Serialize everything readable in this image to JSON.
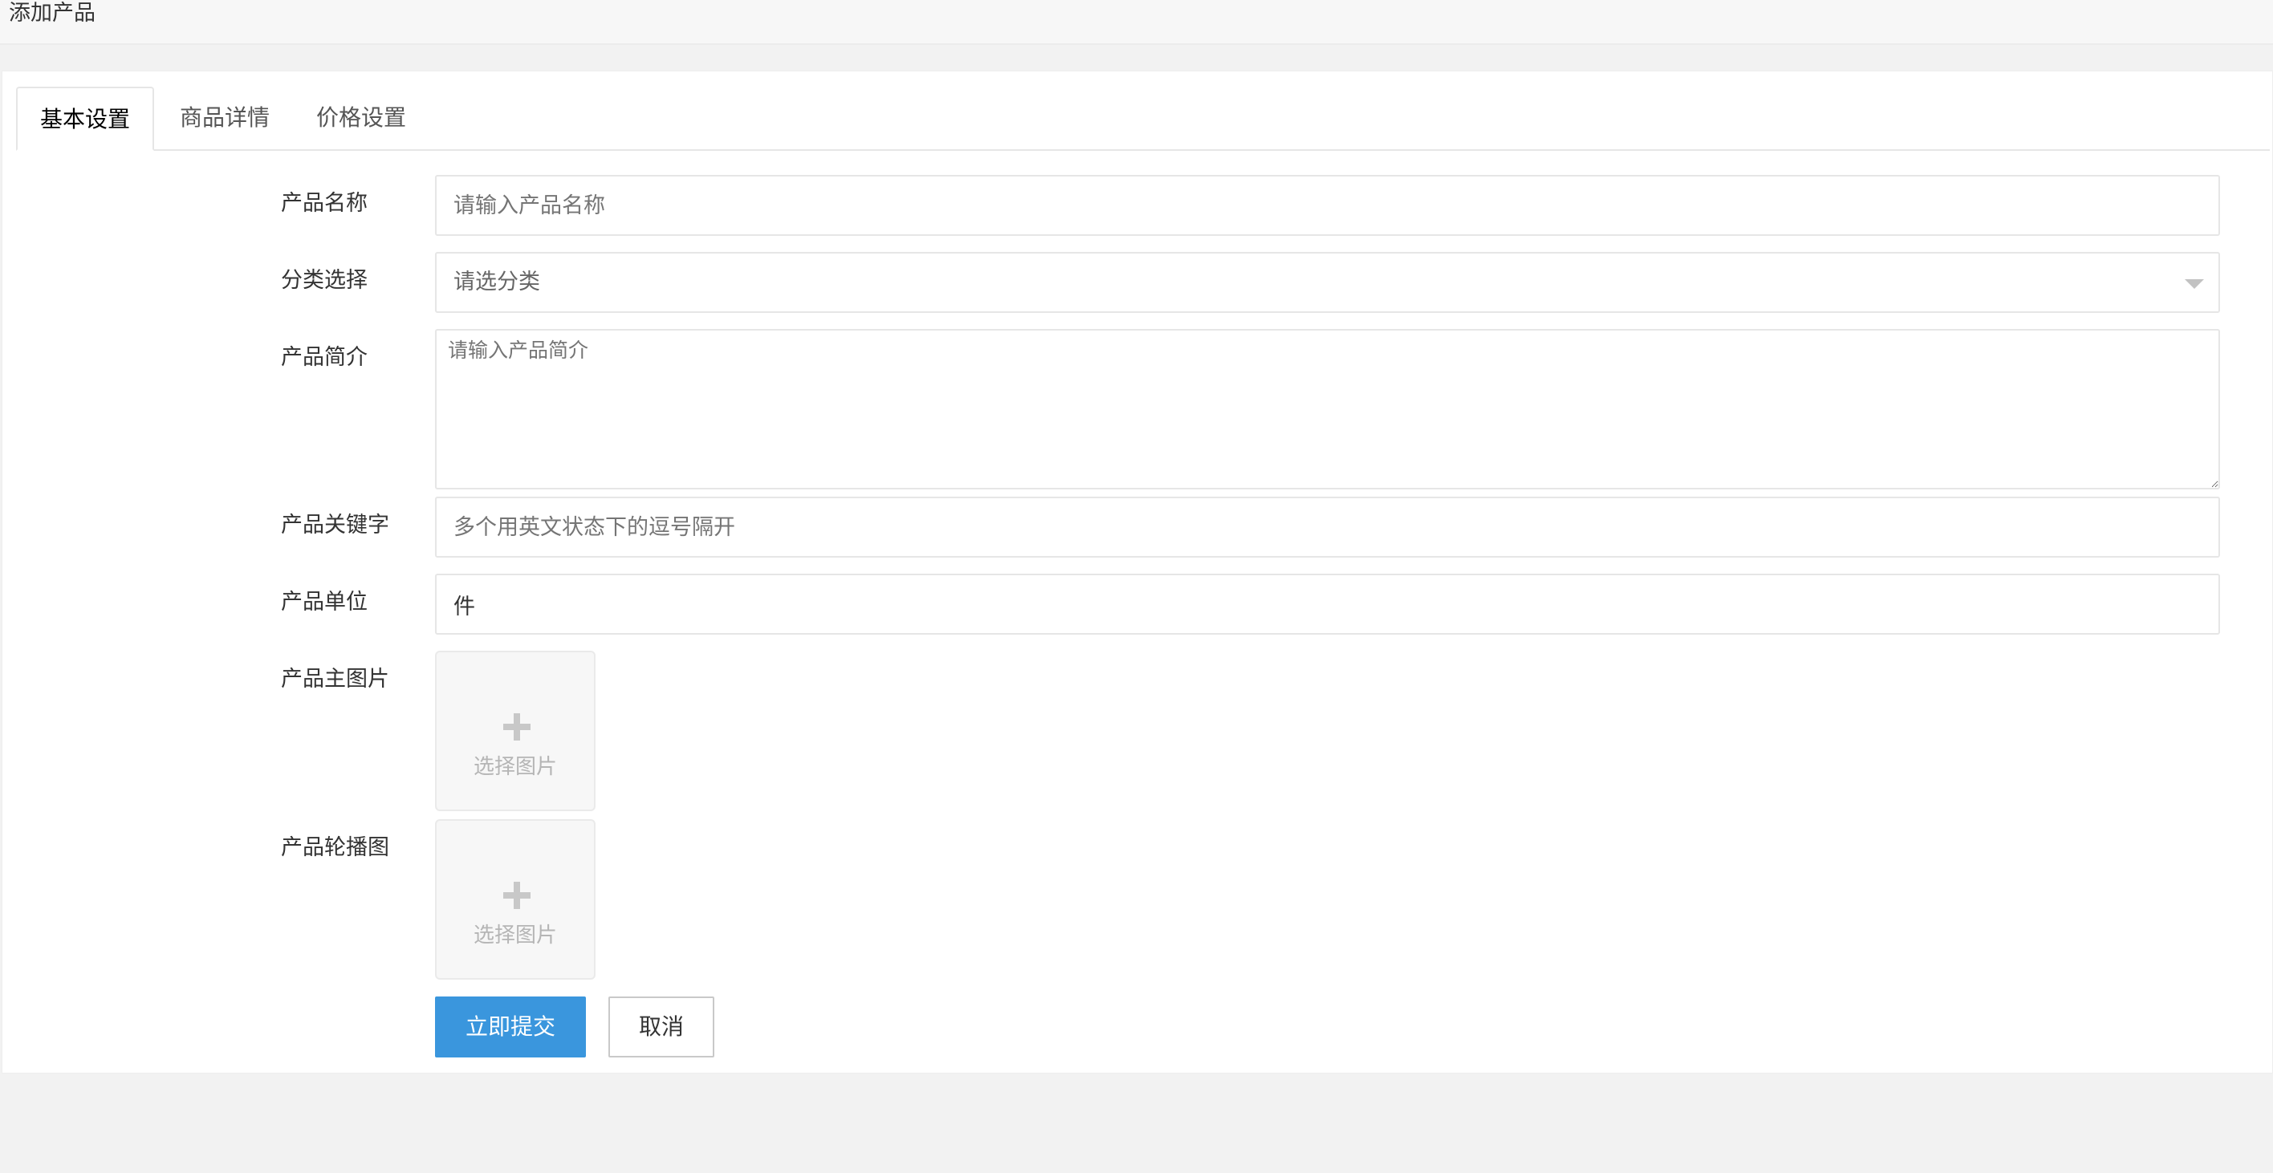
{
  "page": {
    "title": "添加产品"
  },
  "tabs": [
    {
      "label": "基本设置",
      "active": true
    },
    {
      "label": "商品详情",
      "active": false
    },
    {
      "label": "价格设置",
      "active": false
    }
  ],
  "form": {
    "name": {
      "label": "产品名称",
      "placeholder": "请输入产品名称",
      "value": ""
    },
    "category": {
      "label": "分类选择",
      "selected": "请选分类"
    },
    "summary": {
      "label": "产品简介",
      "placeholder": "请输入产品简介",
      "value": ""
    },
    "keywords": {
      "label": "产品关键字",
      "placeholder": "多个用英文状态下的逗号隔开",
      "value": ""
    },
    "unit": {
      "label": "产品单位",
      "value": "件"
    },
    "main_image": {
      "label": "产品主图片",
      "upload_text": "选择图片"
    },
    "carousel": {
      "label": "产品轮播图",
      "upload_text": "选择图片"
    }
  },
  "actions": {
    "submit_label": "立即提交",
    "cancel_label": "取消"
  },
  "colors": {
    "primary": "#3a96dd",
    "background": "#f2f2f2",
    "card": "#ffffff",
    "border": "#e6e6e6"
  },
  "icons": {
    "select_caret": "caret-down-icon",
    "upload": "plus-icon"
  }
}
